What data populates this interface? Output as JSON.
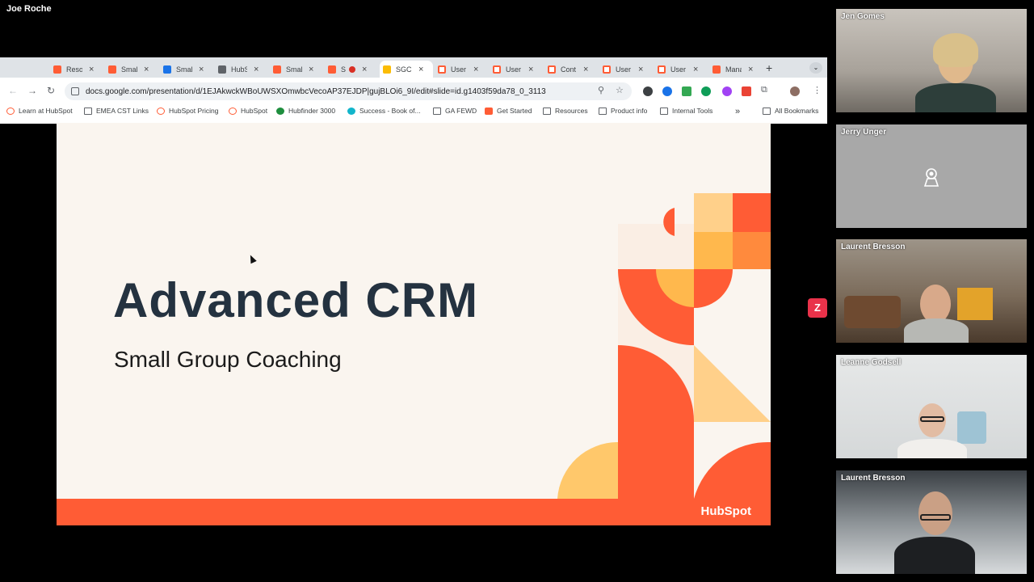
{
  "meeting": {
    "presenter_name": "Joe Roche"
  },
  "browser": {
    "tabs": [
      {
        "label": "Reso",
        "icon": "hubspot-icon"
      },
      {
        "label": "Smal",
        "icon": "hubspot-icon"
      },
      {
        "label": "Smal",
        "icon": "chrome-icon"
      },
      {
        "label": "HubS",
        "icon": "page-icon"
      },
      {
        "label": "Smal",
        "icon": "hubspot-icon"
      },
      {
        "label": "S",
        "icon": "hubspot-icon"
      },
      {
        "label": "SGC",
        "icon": "slides-icon",
        "active": true
      },
      {
        "label": "User",
        "icon": "hubspot-icon"
      },
      {
        "label": "User",
        "icon": "hubspot-icon"
      },
      {
        "label": "Cont",
        "icon": "hubspot-icon"
      },
      {
        "label": "User",
        "icon": "hubspot-icon"
      },
      {
        "label": "User",
        "icon": "hubspot-icon"
      },
      {
        "label": "Mana",
        "icon": "hubspot-icon"
      }
    ],
    "url": "docs.google.com/presentation/d/1EJAkwckWBoUWSXOmwbcVecoAP37EJDP|gujBLOi6_9I/edit#slide=id.g1403f59da78_0_3113",
    "bookmarks": [
      {
        "label": "Learn at HubSpot",
        "icon": "hubspot"
      },
      {
        "label": "EMEA CST Links",
        "icon": "folder"
      },
      {
        "label": "HubSpot Pricing",
        "icon": "hubspot"
      },
      {
        "label": "HubSpot",
        "icon": "hubspot"
      },
      {
        "label": "Hubfinder 3000",
        "icon": "green"
      },
      {
        "label": "Success - Book of...",
        "icon": "teal"
      },
      {
        "label": "GA FEWD",
        "icon": "folder"
      },
      {
        "label": "Get Started",
        "icon": "hubspot"
      },
      {
        "label": "Resources",
        "icon": "folder"
      },
      {
        "label": "Product info",
        "icon": "folder"
      },
      {
        "label": "Internal Tools",
        "icon": "folder"
      }
    ],
    "all_bookmarks": "All Bookmarks",
    "overflow": "»"
  },
  "slide": {
    "title": "Advanced CRM",
    "subtitle": "Small Group Coaching",
    "logo": "HubSpot",
    "colors": {
      "primary": "#ff5c35",
      "light_orange": "#ffb84d",
      "peach": "#fdd9a8",
      "title": "#243240"
    }
  },
  "zoom_badge": "Z",
  "participants": [
    {
      "name": "Jen Gomes"
    },
    {
      "name": "Jerry Unger"
    },
    {
      "name": "Laurent Bresson"
    },
    {
      "name": "Leanne Godsell"
    },
    {
      "name": "Laurent Bresson"
    }
  ]
}
